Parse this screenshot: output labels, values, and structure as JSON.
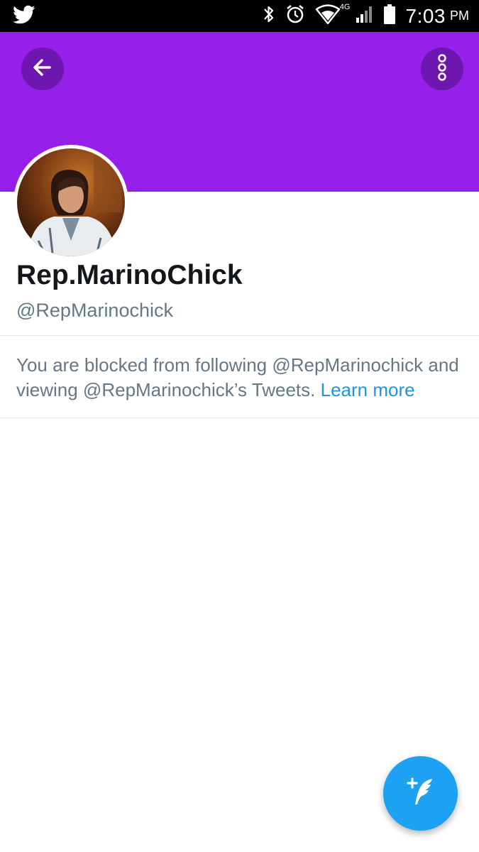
{
  "status_bar": {
    "network_label": "4G",
    "time": "7:03",
    "ampm": "PM"
  },
  "header": {
    "banner_color": "#9620ea",
    "button_color": "#6e16b0"
  },
  "profile": {
    "display_name": "Rep.MarinoChick",
    "handle": "@RepMarinochick"
  },
  "blocked_notice": {
    "message": "You are blocked from following @RepMarinochick and viewing @RepMarinochick’s Tweets.",
    "link_label": "Learn more"
  },
  "colors": {
    "link": "#1b95e0",
    "fab": "#1da1f2",
    "secondary_text": "#657786"
  },
  "icons": {
    "status_left": "twitter-bird-icon",
    "bluetooth": "bluetooth-icon",
    "alarm": "alarm-icon",
    "wifi": "wifi-icon",
    "signal": "signal-icon",
    "battery": "battery-icon",
    "back": "arrow-left-icon",
    "more": "more-vertical-icon",
    "compose": "compose-quill-icon"
  }
}
